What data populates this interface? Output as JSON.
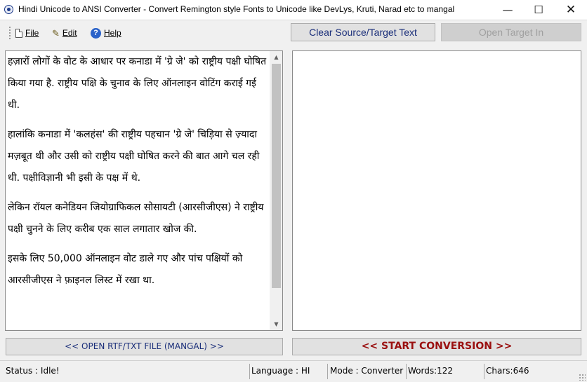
{
  "window": {
    "title": "Hindi Unicode to ANSI Converter - Convert Remington style Fonts to Unicode like DevLys, Kruti, Narad etc to mangal",
    "minimize_glyph": "—",
    "maximize_glyph": "☐",
    "close_glyph": "✕"
  },
  "menu": {
    "file_label": "File",
    "edit_label": "Edit",
    "help_label": "Help",
    "edit_icon_glyph": "✎",
    "help_icon_glyph": "?"
  },
  "toolbar": {
    "clear_label": "Clear Source/Target Text",
    "open_target_label": "Open Target In"
  },
  "source": {
    "paragraphs": [
      "हज़ारों लोगों के वोट के आधार पर कनाडा में 'ग्रे जे' को राष्ट्रीय पक्षी घोषित किया गया है. राष्ट्रीय पक्षि के चुनाव के लिए ऑनलाइन वोटिंग कराई गई थी.",
      "हालांकि कनाडा में 'कलहंस' की राष्ट्रीय पहचान 'ग्रे जे' चिड़िया से ज़्यादा मज़बूत थी और उसी को राष्ट्रीय पक्षी घोषित करने की बात आगे चल रही थी. पक्षीविज्ञानी भी इसी के पक्ष में थे.",
      "लेकिन रॉयल कनेडियन जियोग्राफिकल सोसायटी (आरसीजीएस) ने राष्ट्रीय पक्षी चुनने के लिए करीब एक साल लगातार खोज की.",
      "इसके लिए 50,000 ऑनलाइन वोट डाले गए और पांच पक्षियों को आरसीजीएस ने फ़ाइनल लिस्ट में रखा था."
    ]
  },
  "actions": {
    "open_file_label": "<< OPEN RTF/TXT FILE (MANGAL) >>",
    "start_label": "<< START CONVERSION >>"
  },
  "status": {
    "status_text": "Status :  Idle!",
    "language_text": "Language : HI",
    "mode_text": "Mode : Converter",
    "words_text": "Words:122",
    "chars_text": "Chars:646"
  },
  "colors": {
    "accent_blue": "#1b2f7a",
    "start_red": "#9a1010"
  }
}
